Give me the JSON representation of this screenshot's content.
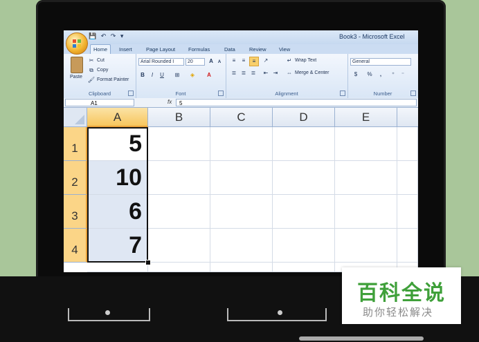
{
  "window": {
    "title": "Book3 - Microsoft Excel"
  },
  "qat": {
    "save": "💾",
    "undo": "↶",
    "redo": "↷",
    "more": "▾"
  },
  "tabs": [
    "Home",
    "Insert",
    "Page Layout",
    "Formulas",
    "Data",
    "Review",
    "View"
  ],
  "ribbon": {
    "clipboard": {
      "label": "Clipboard",
      "paste": "Paste",
      "cut": "Cut",
      "copy": "Copy",
      "format_painter": "Format Painter"
    },
    "font": {
      "label": "Font",
      "family": "Arial Rounded I",
      "size": "20",
      "bold": "B",
      "italic": "I",
      "underline": "U",
      "grow": "A",
      "shrink": "A"
    },
    "alignment": {
      "label": "Alignment",
      "wrap_text": "Wrap Text",
      "merge_center": "Merge & Center"
    },
    "number": {
      "label": "Number",
      "format": "General",
      "percent": "%",
      "comma": ","
    }
  },
  "formula_bar": {
    "name_box": "A1",
    "fx": "fx",
    "value": "5"
  },
  "sheet": {
    "columns": [
      "A",
      "B",
      "C",
      "D",
      "E"
    ],
    "rows": [
      "1",
      "2",
      "3",
      "4"
    ],
    "colA_values": [
      "5",
      "10",
      "6",
      "7"
    ],
    "selected_column": "A"
  },
  "watermark": {
    "main": "百科全说",
    "sub": "助你轻松解决"
  },
  "colors": {
    "selection_header": "#f7c65e",
    "watermark_green": "#3fa03a"
  }
}
